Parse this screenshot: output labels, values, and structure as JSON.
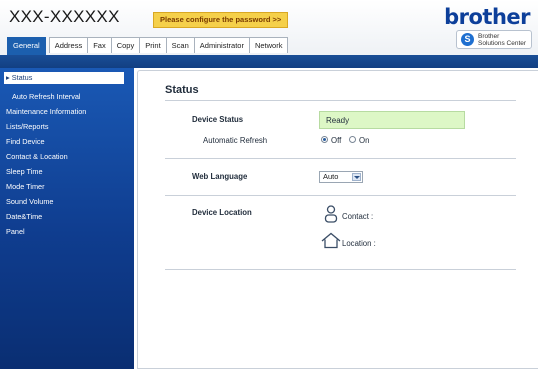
{
  "header": {
    "model": "XXX-XXXXXX",
    "warning": "Please configure the password >>",
    "brand": "brother",
    "solutions_line1": "Brother",
    "solutions_line2": "Solutions Center"
  },
  "tabs": [
    "General",
    "Address",
    "Fax",
    "Copy",
    "Print",
    "Scan",
    "Administrator",
    "Network"
  ],
  "active_tab": "General",
  "sidebar": {
    "items": [
      {
        "label": "Status",
        "active": true
      },
      {
        "label": "Auto Refresh Interval",
        "sub": true
      },
      {
        "label": "Maintenance Information"
      },
      {
        "label": "Lists/Reports"
      },
      {
        "label": "Find Device"
      },
      {
        "label": "Contact & Location"
      },
      {
        "label": "Sleep Time"
      },
      {
        "label": "Mode Timer"
      },
      {
        "label": "Sound Volume"
      },
      {
        "label": "Date&Time"
      },
      {
        "label": "Panel"
      }
    ]
  },
  "main": {
    "title": "Status",
    "device_status_label": "Device Status",
    "device_status_value": "Ready",
    "auto_refresh_label": "Automatic Refresh",
    "refresh_off": "Off",
    "refresh_on": "On",
    "refresh_selected": "Off",
    "web_language_label": "Web Language",
    "web_language_value": "Auto",
    "device_location_label": "Device Location",
    "contact_label": "Contact :",
    "location_label": "Location :"
  },
  "colors": {
    "accent_blue": "#1c5fae",
    "ready_bg": "#ddf7c6",
    "warning_bg": "#f5d04a"
  }
}
